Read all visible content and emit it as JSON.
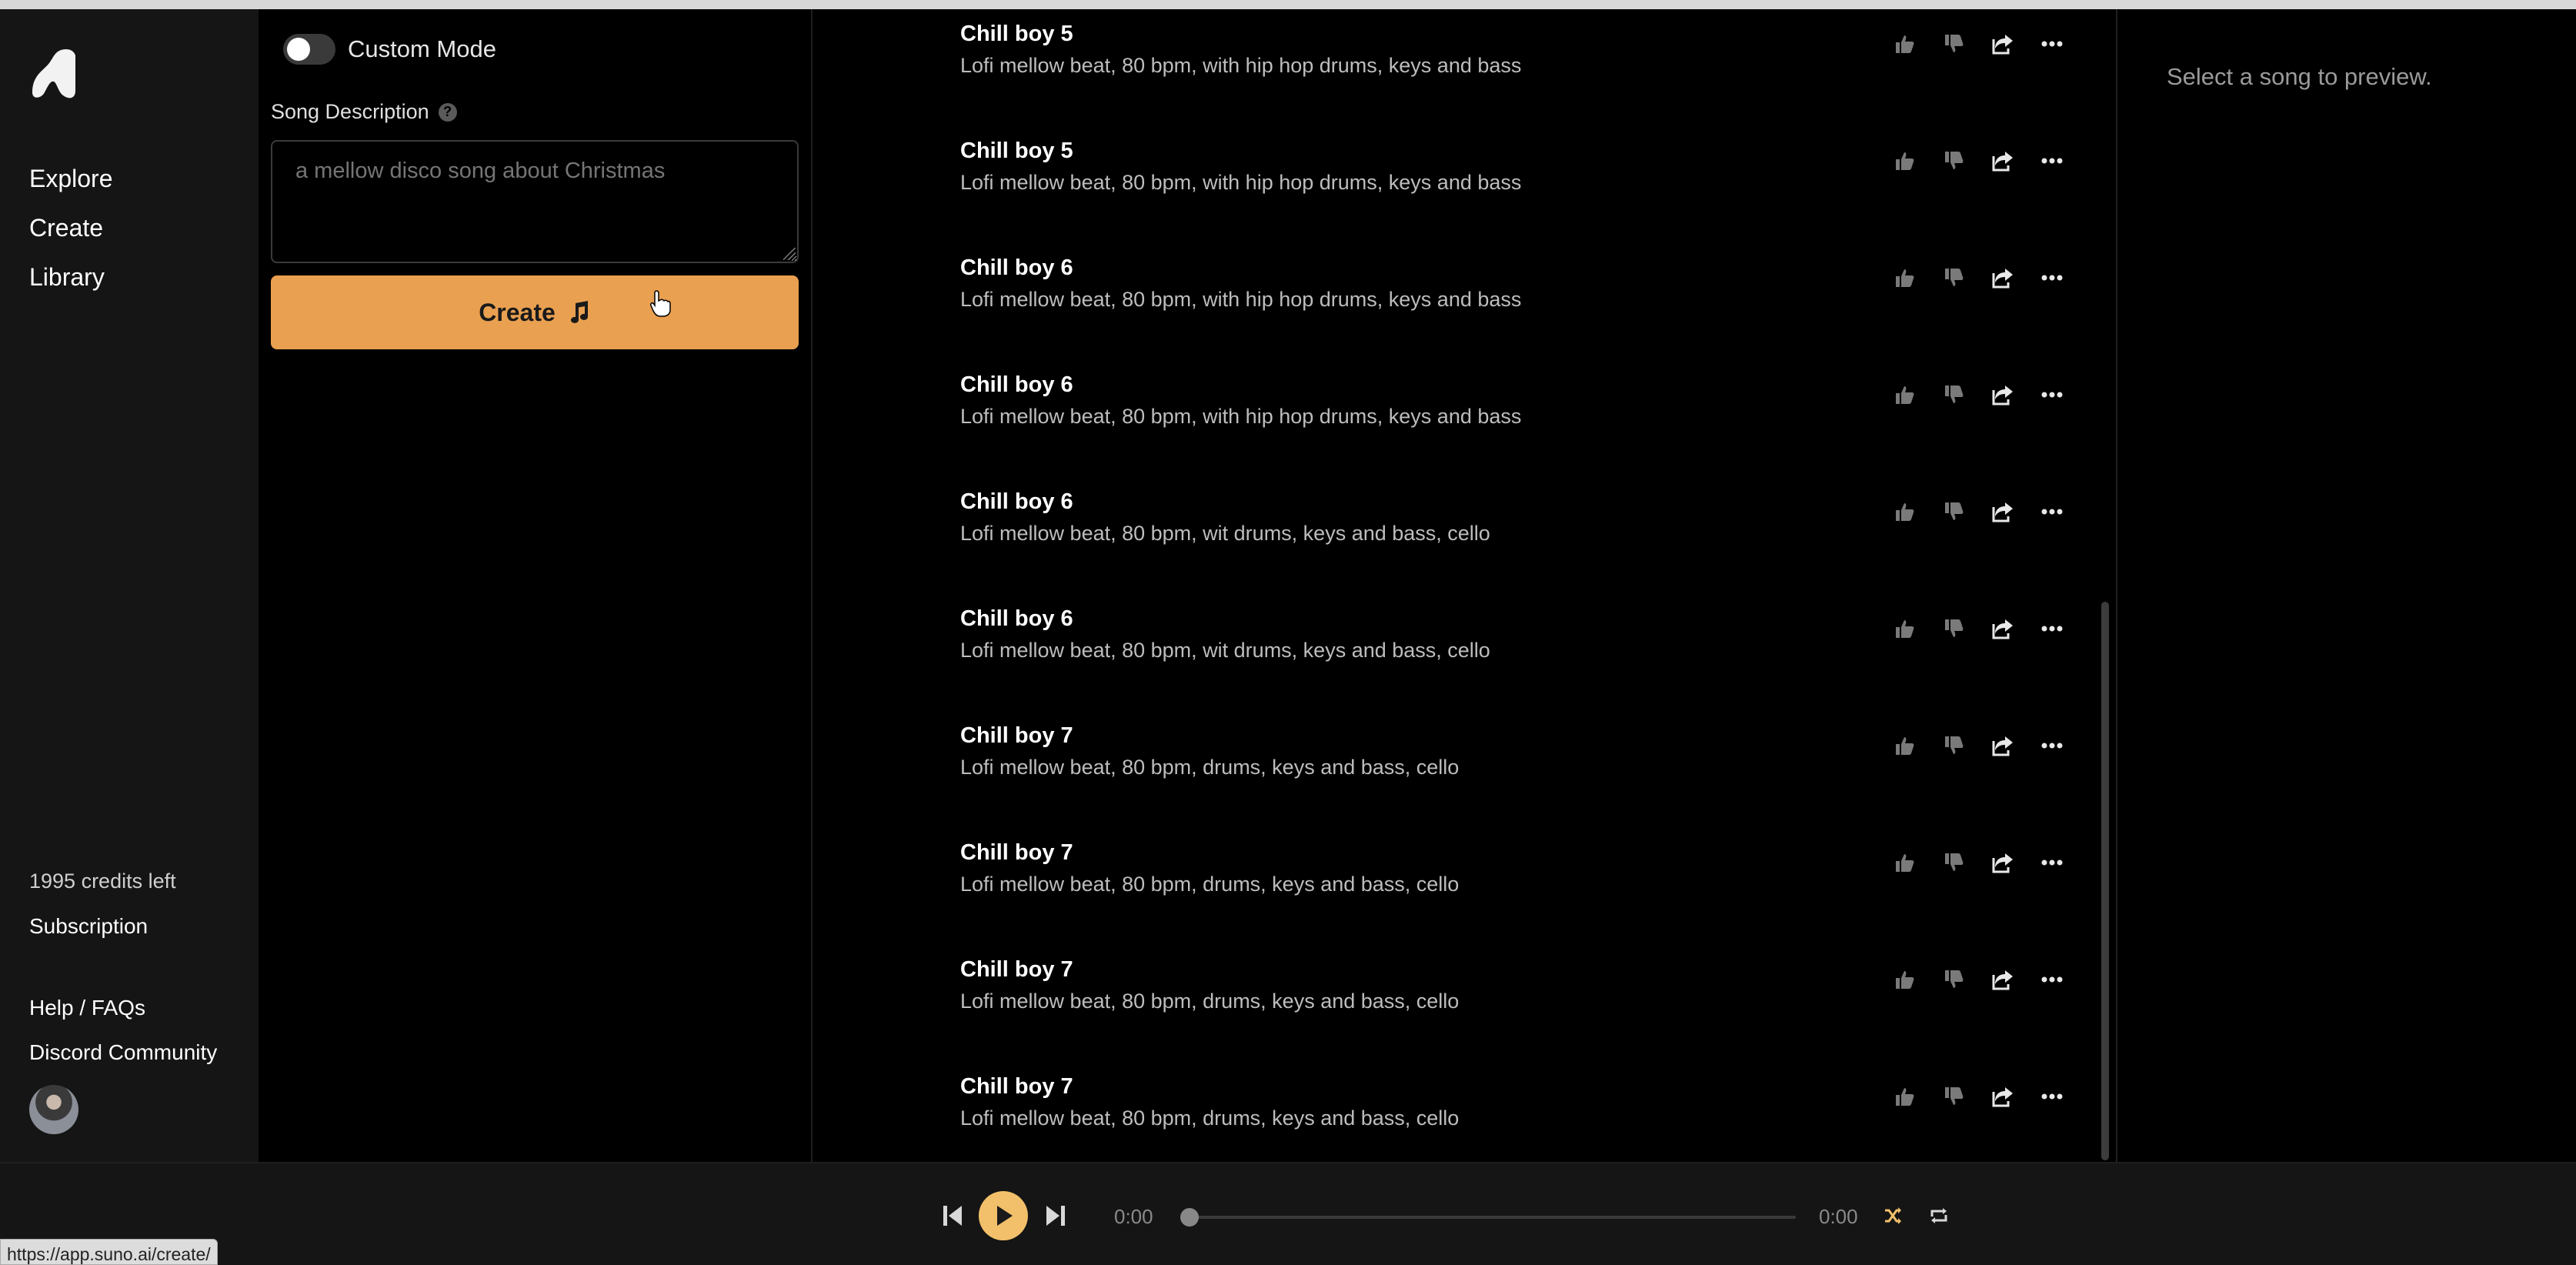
{
  "nav": {
    "links": [
      "Explore",
      "Create",
      "Library"
    ],
    "credits": "1995 credits left",
    "subscription": "Subscription",
    "help": "Help / FAQs",
    "discord": "Discord Community"
  },
  "create": {
    "custom_mode_label": "Custom Mode",
    "custom_mode_on": false,
    "description_label": "Song Description",
    "description_placeholder": "a mellow disco song about Christmas",
    "description_value": "",
    "create_button_label": "Create"
  },
  "songs": [
    {
      "title": "Chill boy 5",
      "desc": "Lofi mellow beat, 80 bpm, with hip hop drums, keys and bass"
    },
    {
      "title": "Chill boy 5",
      "desc": "Lofi mellow beat, 80 bpm, with hip hop drums, keys and bass"
    },
    {
      "title": "Chill boy 6",
      "desc": "Lofi mellow beat, 80 bpm, with hip hop drums, keys and bass"
    },
    {
      "title": "Chill boy 6",
      "desc": "Lofi mellow beat, 80 bpm, with hip hop drums, keys and bass"
    },
    {
      "title": "Chill boy 6",
      "desc": "Lofi mellow beat, 80 bpm, wit drums, keys and bass, cello"
    },
    {
      "title": "Chill boy 6",
      "desc": "Lofi mellow beat, 80 bpm, wit drums, keys and bass, cello"
    },
    {
      "title": "Chill boy 7",
      "desc": "Lofi mellow beat, 80 bpm, drums, keys and bass, cello"
    },
    {
      "title": "Chill boy 7",
      "desc": "Lofi mellow beat, 80 bpm, drums, keys and bass, cello"
    },
    {
      "title": "Chill boy 7",
      "desc": "Lofi mellow beat, 80 bpm, drums, keys and bass, cello"
    },
    {
      "title": "Chill boy 7",
      "desc": "Lofi mellow beat, 80 bpm, drums, keys and bass, cello"
    }
  ],
  "song_actions": [
    "thumbs-up-icon",
    "thumbs-down-icon",
    "share-icon",
    "more-icon"
  ],
  "preview": {
    "text": "Select a song to preview."
  },
  "player": {
    "current_time": "0:00",
    "total_time": "0:00",
    "progress": 0
  },
  "status_url": "https://app.suno.ai/create/",
  "colors": {
    "accent": "#e9a050",
    "play": "#f2c06a",
    "shuffle": "#f2c06a",
    "nav_bg": "#151515"
  }
}
